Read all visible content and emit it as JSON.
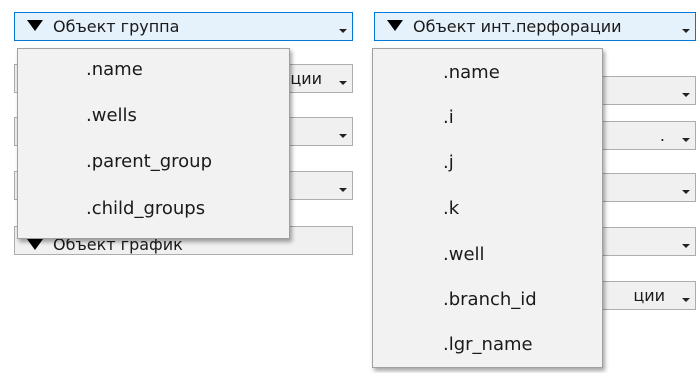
{
  "left": {
    "selector": {
      "label": "Объект группа"
    },
    "background_combos": [
      {
        "label": "ции"
      },
      {
        "label": ""
      },
      {
        "label": ""
      },
      {
        "label": "Объект график"
      }
    ],
    "menu_items": [
      {
        "label": ".name"
      },
      {
        "label": ".wells"
      },
      {
        "label": ".parent_group"
      },
      {
        "label": ".child_groups"
      }
    ]
  },
  "right": {
    "selector": {
      "label": "Объект инт.перфорации"
    },
    "background_combos": [
      {
        "label": ""
      },
      {
        "label": "."
      },
      {
        "label": ""
      },
      {
        "label": ""
      },
      {
        "label": ""
      },
      {
        "label": "ции"
      }
    ],
    "menu_items": [
      {
        "label": ".name"
      },
      {
        "label": ".i"
      },
      {
        "label": ".j"
      },
      {
        "label": ".k"
      },
      {
        "label": ".well"
      },
      {
        "label": ".branch_id"
      },
      {
        "label": ".lgr_name"
      }
    ]
  },
  "colors": {
    "active_border": "#0078d7",
    "active_fill": "#e5f1fb",
    "menu_bg": "#f2f2f2"
  }
}
